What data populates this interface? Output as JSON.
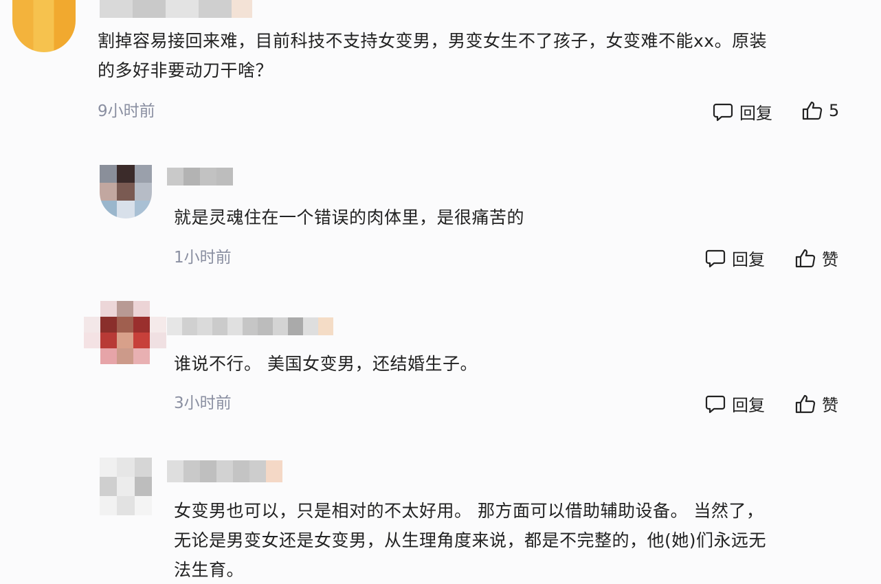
{
  "comments": [
    {
      "text_lines": [
        "割掉容易接回来难，目前科技不支持女变男，男变女生不了孩子，女变难不能xx。原装",
        "的多好非要动刀干啥？"
      ],
      "time": "9小时前",
      "reply_label": "回复",
      "like_label": "5"
    },
    {
      "text_lines": [
        "就是灵魂住在一个错误的肉体里，是很痛苦的"
      ],
      "time": "1小时前",
      "reply_label": "回复",
      "like_label": "赞"
    },
    {
      "text_lines": [
        "谁说不行。 美国女变男，还结婚生子。"
      ],
      "time": "3小时前",
      "reply_label": "回复",
      "like_label": "赞"
    },
    {
      "text_lines": [
        "女变男也可以，只是相对的不太好用。 那方面可以借助辅助设备。 当然了，",
        "无论是男变女还是女变男，从生理角度来说，都是不完整的，他(她)们永远无",
        "法生育。"
      ]
    }
  ],
  "colors": {
    "text": "#222222",
    "meta": "#8a8fa1",
    "background": "#fbfbfc"
  },
  "icons": {
    "reply": "comment-bubble-icon",
    "like": "thumbs-up-icon"
  }
}
